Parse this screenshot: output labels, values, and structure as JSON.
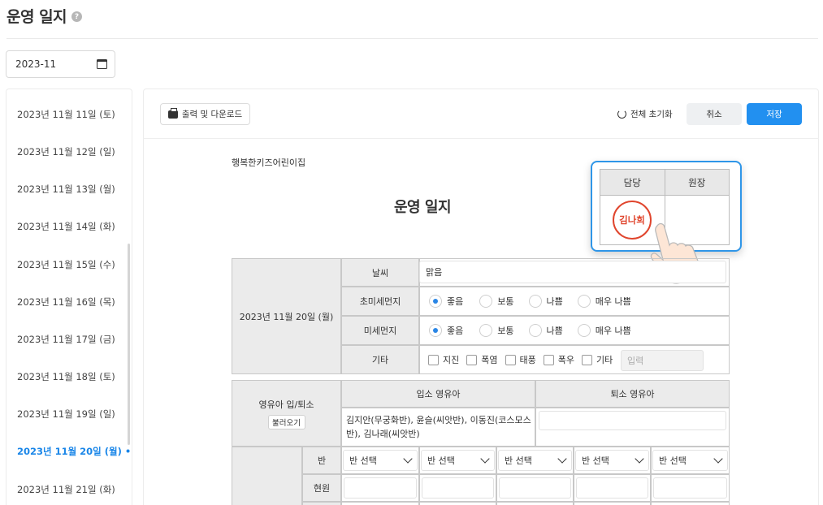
{
  "header": {
    "title": "운영 일지",
    "help_icon": "?"
  },
  "month_picker": {
    "value": "2023-11",
    "icon": "calendar-icon"
  },
  "sidebar": {
    "dates": [
      "2023년 11월 11일 (토)",
      "2023년 11월 12일 (일)",
      "2023년 11월 13일 (월)",
      "2023년 11월 14일 (화)",
      "2023년 11월 15일 (수)",
      "2023년 11월 16일 (목)",
      "2023년 11월 17일 (금)",
      "2023년 11월 18일 (토)",
      "2023년 11월 19일 (일)",
      "2023년 11월 20일 (월)",
      "2023년 11월 21일 (화)"
    ],
    "active_index": 9,
    "active_marker": "•"
  },
  "toolbar": {
    "print_label": "출력 및 다운로드",
    "reset_label": "전체 초기화",
    "cancel_label": "취소",
    "save_label": "저장"
  },
  "document": {
    "org_name": "행복한키즈어린이집",
    "title": "운영 일지",
    "approval": {
      "col1": "담당",
      "col2": "원장",
      "seal_name": "김나희"
    }
  },
  "form": {
    "date": "2023년 11월 20일 (월)",
    "weather_label": "날씨",
    "weather_value": "맑음",
    "ultrafine_dust_label": "초미세먼지",
    "fine_dust_label": "미세먼지",
    "air_options": [
      "좋음",
      "보통",
      "나쁨",
      "매우 나쁨"
    ],
    "ultrafine_selected": "좋음",
    "fine_selected": "좋음",
    "etc_label": "기타",
    "etc_options": [
      "지진",
      "폭염",
      "태풍",
      "폭우",
      "기타"
    ],
    "etc_input_placeholder": "입력",
    "infant_inout_label": "영유아 입/퇴소",
    "load_button": "불러오기",
    "admission_header": "입소 영유아",
    "discharge_header": "퇴소 영유아",
    "admission_value": "김지안(무궁화반), 윤슬(씨앗반), 이동진(코스모스반), 김나래(씨앗반)",
    "class_row_label": "반",
    "class_select_value": "반 선택",
    "current_row_label": "현원"
  }
}
